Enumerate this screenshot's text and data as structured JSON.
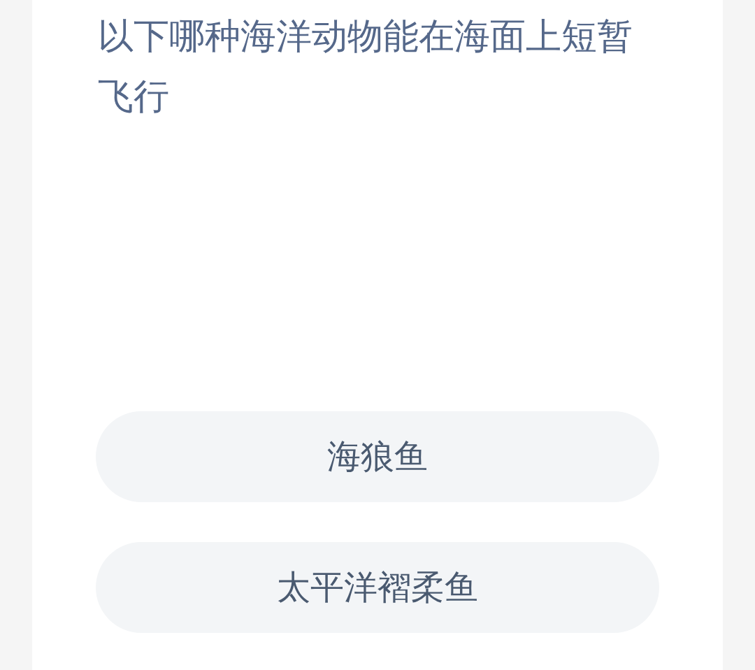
{
  "question": "以下哪种海洋动物能在海面上短暂飞行",
  "options": [
    {
      "label": "海狼鱼"
    },
    {
      "label": "太平洋褶柔鱼"
    }
  ]
}
